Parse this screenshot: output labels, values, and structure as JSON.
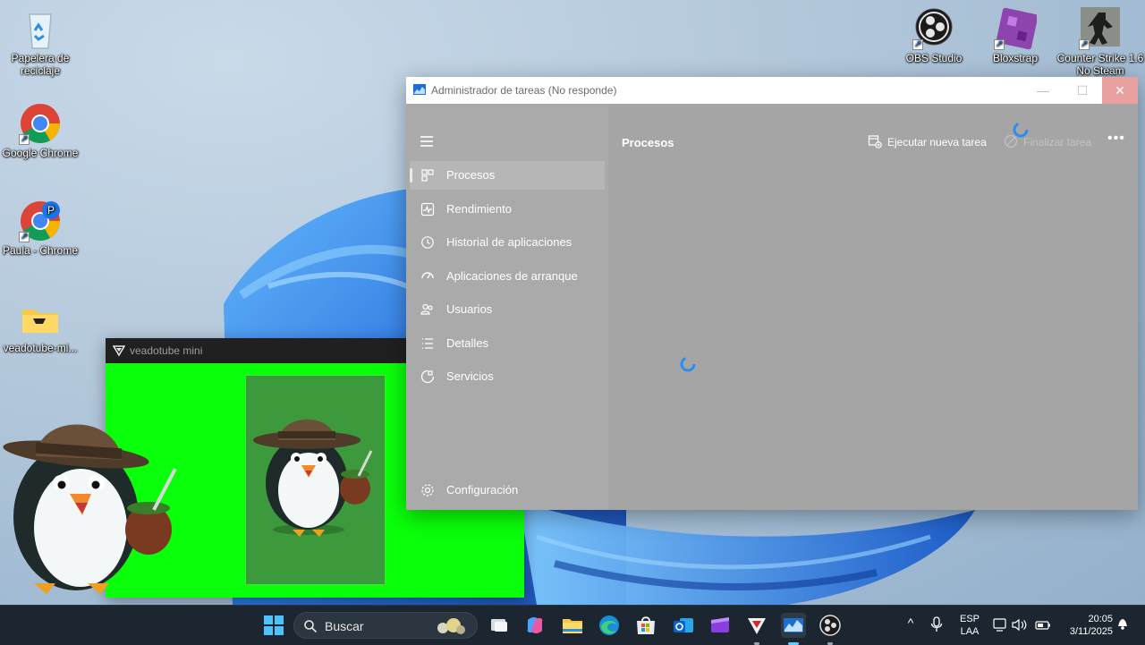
{
  "desktop": {
    "icons": [
      {
        "label": "Papelera de reciclaje",
        "icon": "recycle-bin-icon"
      },
      {
        "label": "Google Chrome",
        "icon": "chrome-icon"
      },
      {
        "label": "Paula - Chrome",
        "icon": "chrome-profile-icon"
      },
      {
        "label": "veadotube-mi...",
        "icon": "folder-icon"
      },
      {
        "label": "OBS Studio",
        "icon": "obs-icon"
      },
      {
        "label": "Bloxstrap",
        "icon": "bloxstrap-icon"
      },
      {
        "label": "Counter Strike 1.6 No Steam",
        "icon": "counter-strike-icon"
      }
    ]
  },
  "taskmanager": {
    "title": "Administrador de tareas (No responde)",
    "header_title": "Procesos",
    "run_new_task": "Ejecutar nueva tarea",
    "end_task": "Finalizar tarea",
    "more": "•••",
    "nav": [
      {
        "label": "Procesos",
        "icon": "processes-icon",
        "active": true
      },
      {
        "label": "Rendimiento",
        "icon": "performance-icon"
      },
      {
        "label": "Historial de aplicaciones",
        "icon": "history-icon"
      },
      {
        "label": "Aplicaciones de arranque",
        "icon": "startup-icon"
      },
      {
        "label": "Usuarios",
        "icon": "users-icon"
      },
      {
        "label": "Detalles",
        "icon": "details-icon"
      },
      {
        "label": "Servicios",
        "icon": "services-icon"
      }
    ],
    "settings": "Configuración"
  },
  "veadotube": {
    "title": "veadotube mini"
  },
  "taskbar": {
    "search_label": "Buscar",
    "language": {
      "line1": "ESP",
      "line2": "LAA"
    },
    "time": "20:05",
    "date": "3/11/2025"
  },
  "colors": {
    "accent": "#1c6fd1",
    "chroma_green": "#0aff0a",
    "taskbar_bg": "#1c2630",
    "taskmanager_gray": "#aaaaaa"
  }
}
